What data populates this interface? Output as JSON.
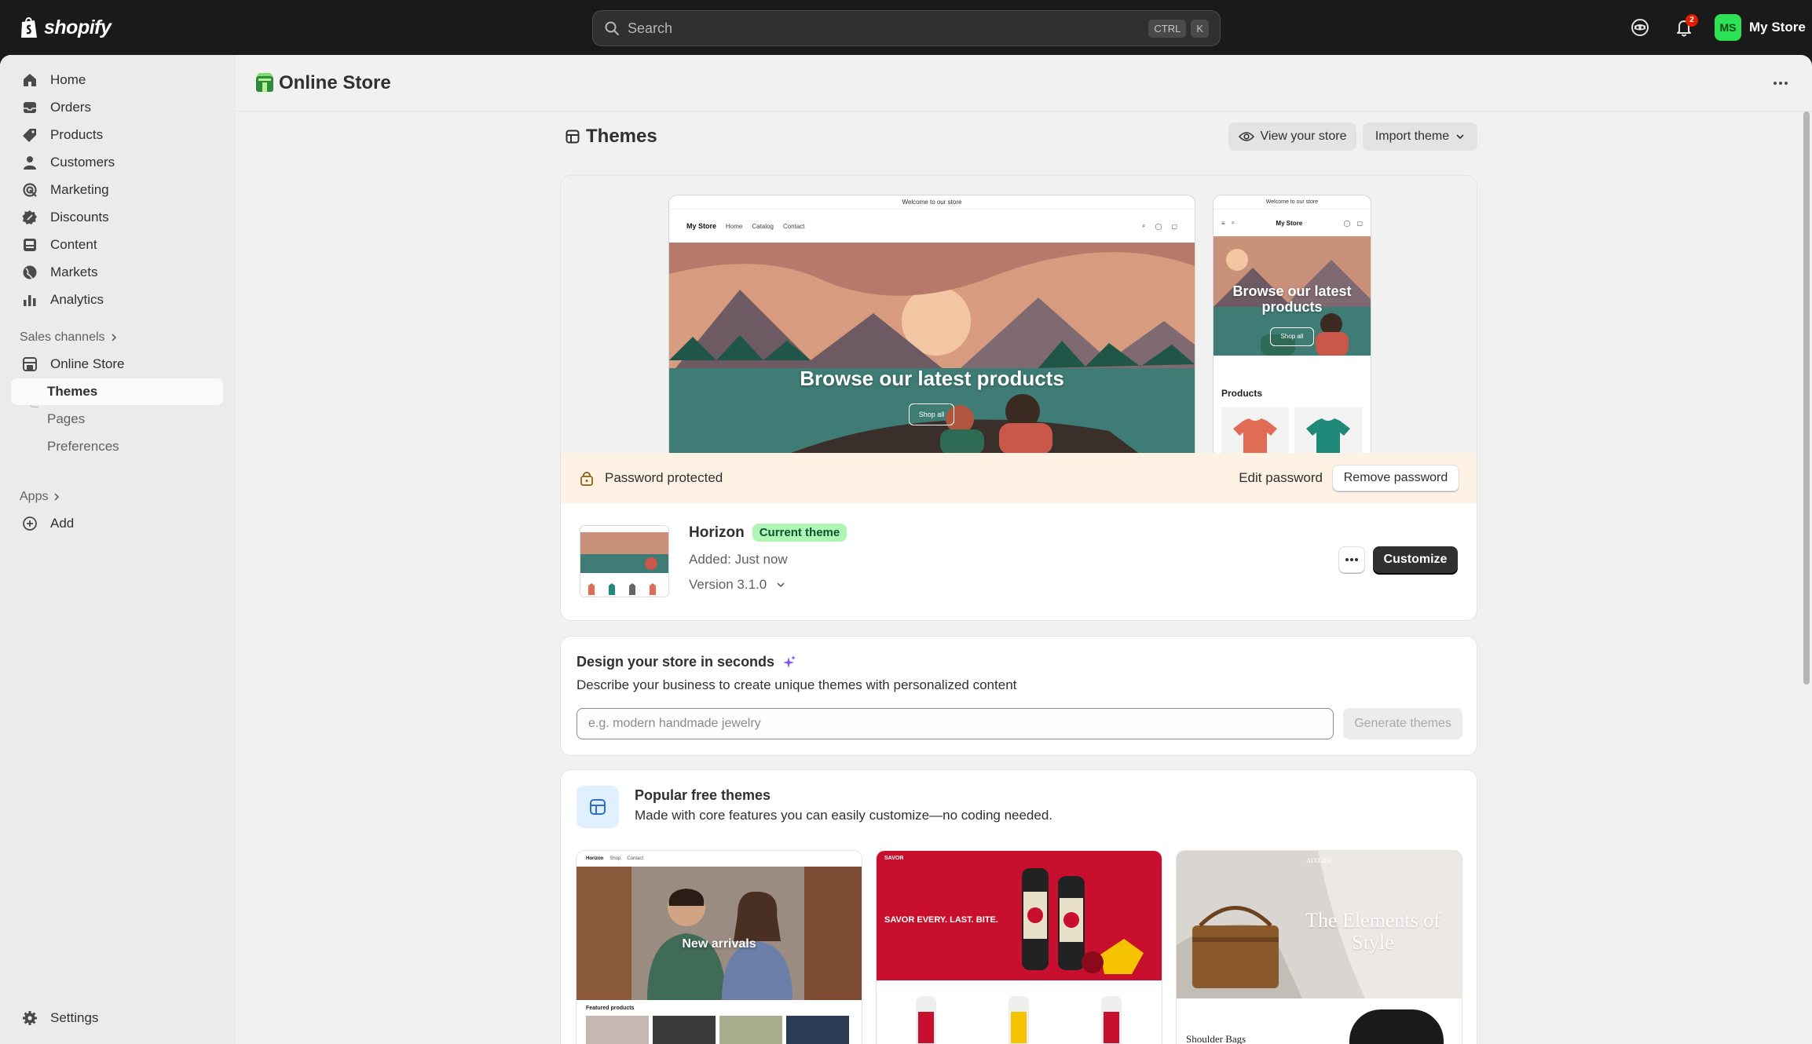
{
  "topbar": {
    "logo_text": "shopify",
    "search_placeholder": "Search",
    "shortcut_key1": "CTRL",
    "shortcut_key2": "K",
    "notification_count": "2",
    "avatar_initials": "MS",
    "store_name": "My Store"
  },
  "sidebar": {
    "items": [
      {
        "label": "Home",
        "icon": "home-icon"
      },
      {
        "label": "Orders",
        "icon": "orders-icon"
      },
      {
        "label": "Products",
        "icon": "tag-icon"
      },
      {
        "label": "Customers",
        "icon": "person-icon"
      },
      {
        "label": "Marketing",
        "icon": "target-icon"
      },
      {
        "label": "Discounts",
        "icon": "discount-icon"
      },
      {
        "label": "Content",
        "icon": "content-icon"
      },
      {
        "label": "Markets",
        "icon": "globe-icon"
      },
      {
        "label": "Analytics",
        "icon": "chart-icon"
      }
    ],
    "sales_channels_label": "Sales channels",
    "online_store_label": "Online Store",
    "sub_items": [
      "Themes",
      "Pages",
      "Preferences"
    ],
    "apps_label": "Apps",
    "add_label": "Add",
    "settings_label": "Settings"
  },
  "page": {
    "title": "Online Store"
  },
  "themes": {
    "title": "Themes",
    "view_store_label": "View your store",
    "import_theme_label": "Import theme",
    "preview": {
      "announcement": "Welcome to our store",
      "store_name": "My Store",
      "nav_links": [
        "Home",
        "Catalog",
        "Contact"
      ],
      "hero_heading": "Browse our latest products",
      "shop_all": "Shop all",
      "mobile_hero_heading": "Browse our latest products",
      "products_heading": "Products"
    },
    "password_text": "Password protected",
    "edit_password_label": "Edit password",
    "remove_password_label": "Remove password",
    "current": {
      "name": "Horizon",
      "badge": "Current theme",
      "added": "Added: Just now",
      "version": "Version 3.1.0",
      "customize_label": "Customize"
    }
  },
  "design": {
    "title": "Design your store in seconds",
    "description": "Describe your business to create unique themes with personalized content",
    "input_placeholder": "e.g. modern handmade jewelry",
    "generate_label": "Generate themes"
  },
  "popular": {
    "title": "Popular free themes",
    "description": "Made with core features you can easily customize—no coding needed.",
    "cards": [
      {
        "hero": "New arrivals",
        "featured": "Featured products"
      },
      {
        "hero": "SAVOR EVERY. LAST. BITE.",
        "brand": "SAVOR"
      },
      {
        "hero": "The Elements of Style",
        "brand": "ATELIER",
        "caption": "Shoulder Bags"
      }
    ]
  },
  "colors": {
    "topbar_bg": "#1a1a1a",
    "frame_bg": "#f1f1f1",
    "sidebar_bg": "#ebebeb",
    "password_bar_bg": "#fff1e3",
    "current_badge_bg": "#aff5b4",
    "avatar_bg": "#2ee255",
    "primary_button_bg": "#303030"
  }
}
